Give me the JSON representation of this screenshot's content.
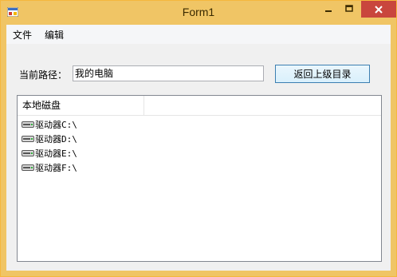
{
  "window": {
    "title": "Form1"
  },
  "menu": {
    "items": [
      "文件",
      "编辑"
    ]
  },
  "path": {
    "label": "当前路径：",
    "value": "我的电脑"
  },
  "back_button": {
    "label": "返回上级目录"
  },
  "listview": {
    "column_header": "本地磁盘",
    "rows": [
      "驱动器C:\\",
      "驱动器D:\\",
      "驱动器E:\\",
      "驱动器F:\\"
    ]
  },
  "colors": {
    "titlebar": "#f0c565",
    "close": "#c9463d",
    "button_border": "#3c7fb1"
  }
}
